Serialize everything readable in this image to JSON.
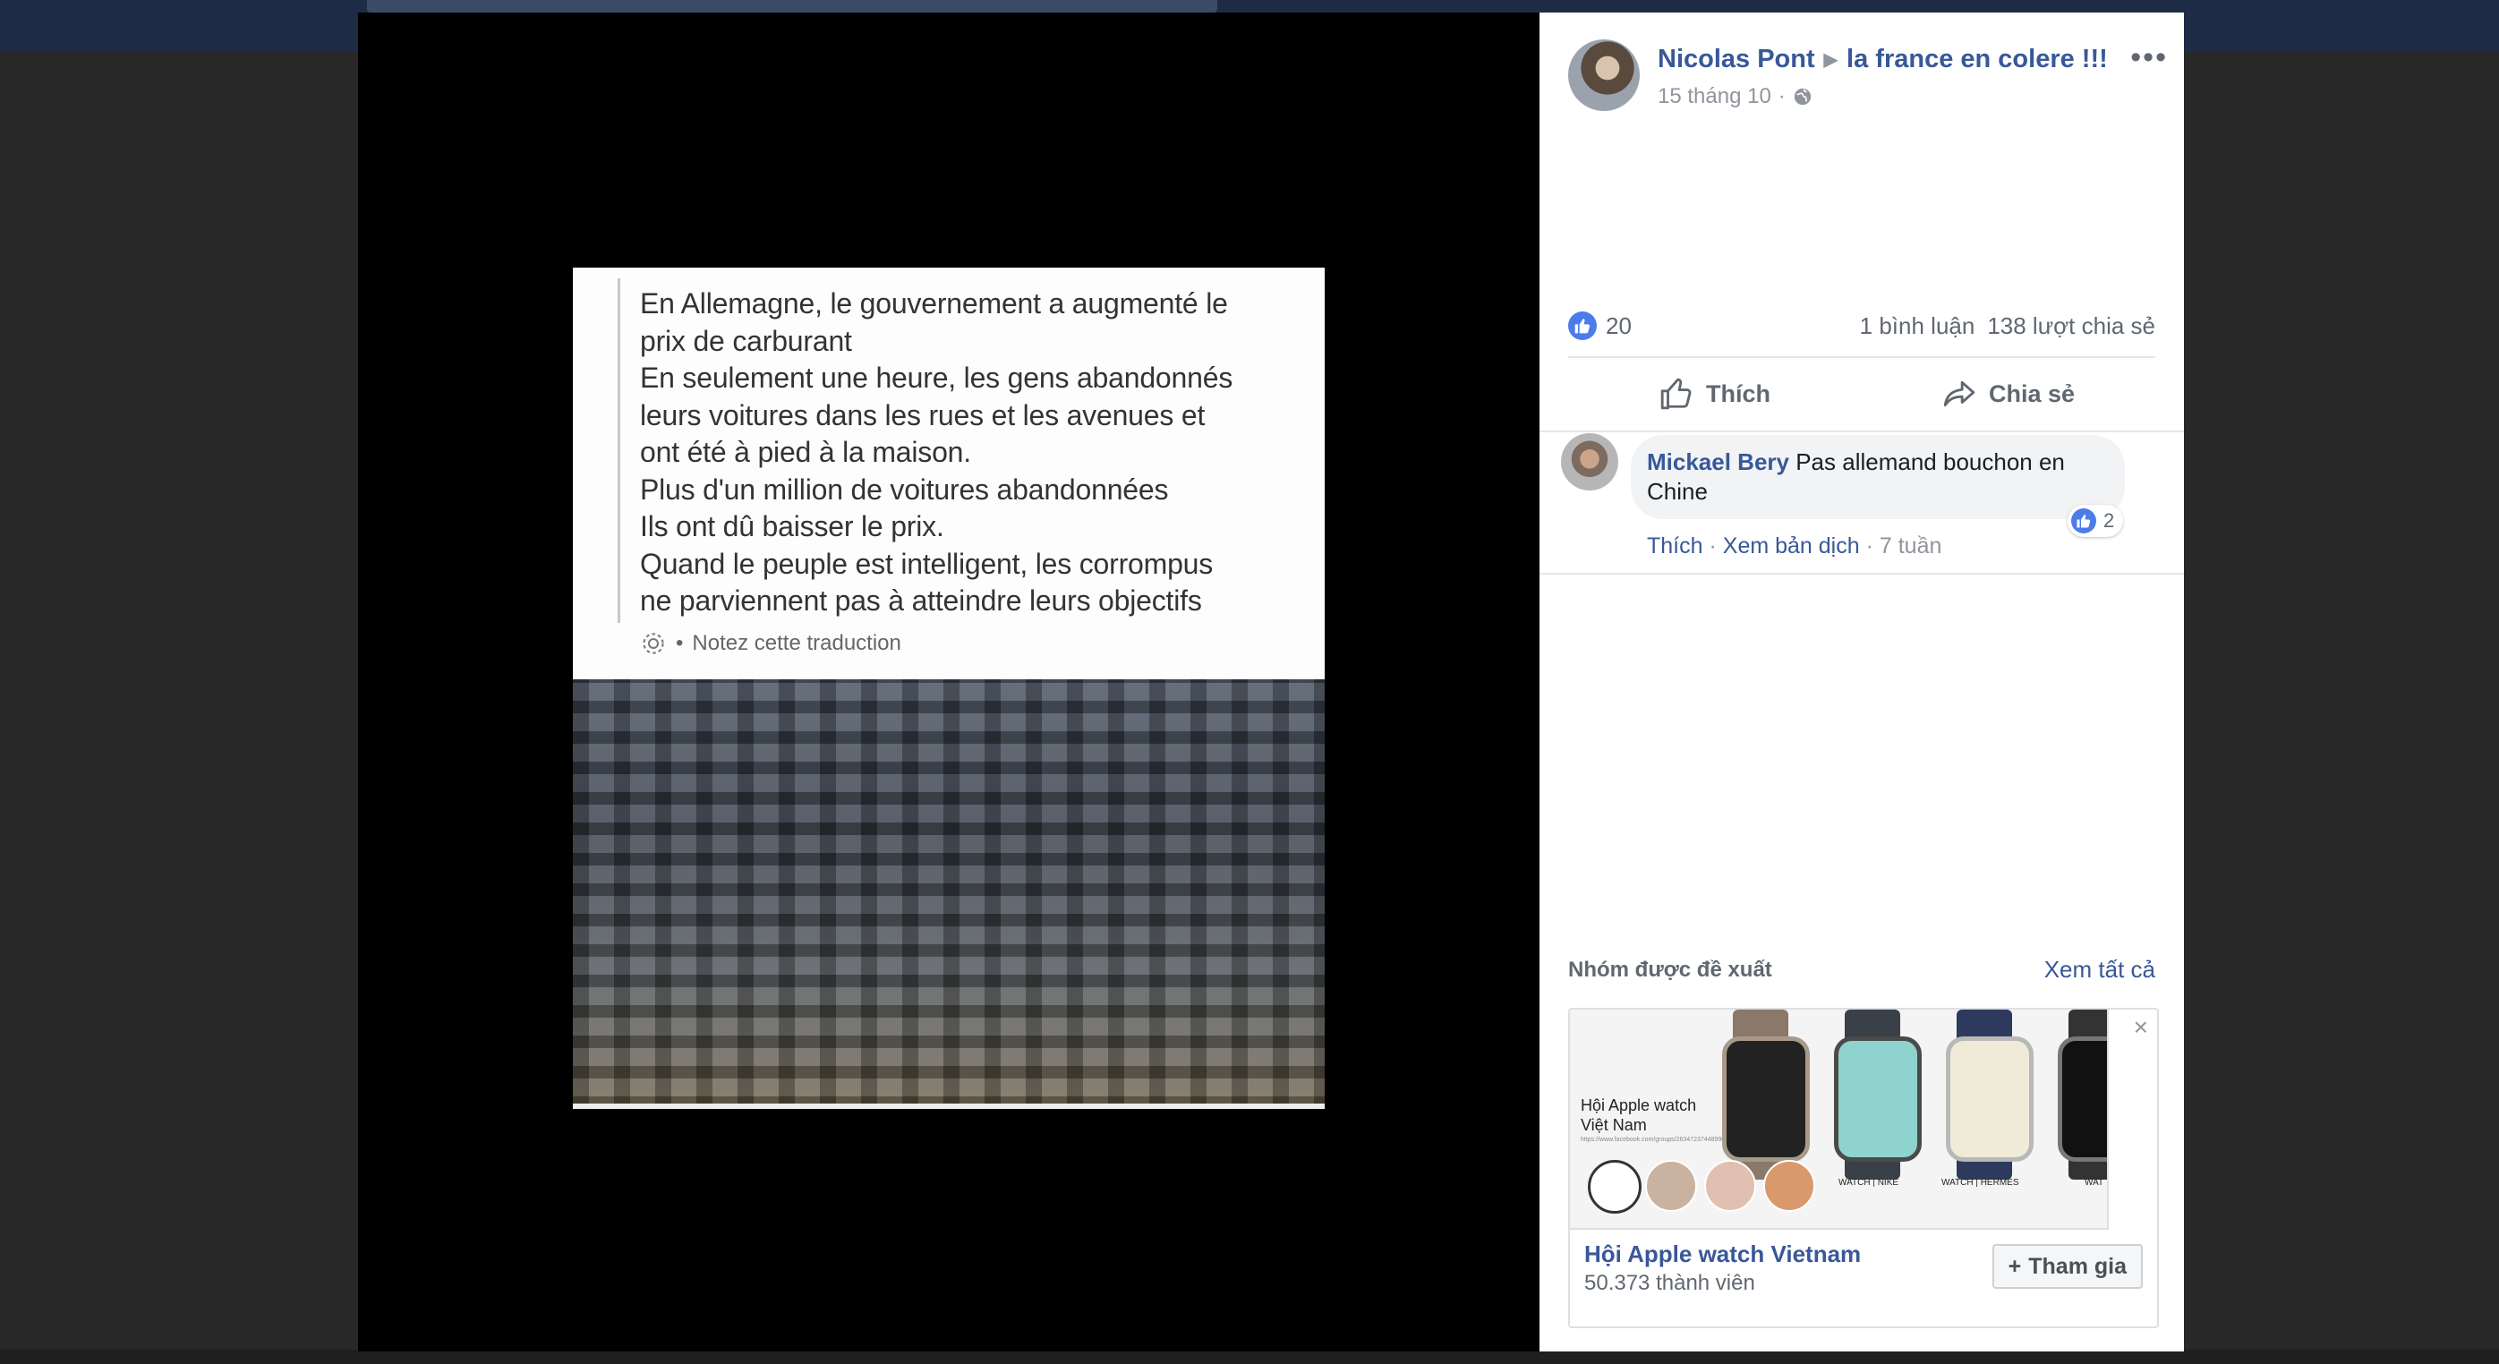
{
  "post_image": {
    "quote_text": "En Allemagne, le gouvernement a augmenté le\nprix de carburant\nEn seulement une heure, les gens abandonnés\nleurs voitures dans les rues et les avenues et\nont été à pied à la maison.\nPlus d'un million de voitures abandonnées\nIls ont dû baisser le prix.\nQuand le peuple est intelligent, les corrompus\nne parviennent pas à atteindre leurs objectifs",
    "note_separator": "•",
    "note_label": "Notez cette traduction"
  },
  "post": {
    "author": "Nicolas Pont",
    "group": "la france en colere !!!",
    "date": "15 tháng 10",
    "meta_separator": "·",
    "more_label": "•••",
    "privacy_icon": "globe-icon"
  },
  "stats": {
    "likes": "20",
    "comments": "1 bình luận",
    "shares": "138 lượt chia sẻ"
  },
  "actions": {
    "like_label": "Thích",
    "share_label": "Chia sẻ"
  },
  "comment": {
    "author": "Mickael Bery",
    "text": "Pas allemand bouchon en Chine",
    "like_label": "Thích",
    "sep1": "·",
    "translate_label": "Xem bản dịch",
    "sep2": "·",
    "time": "7 tuần",
    "reaction_count": "2"
  },
  "suggested": {
    "title": "Nhóm được đề xuất",
    "see_all": "Xem tất cả",
    "close_label": "×",
    "image_title": "Hội Apple watch\nViệt Nam",
    "image_url": "https://www.facebook.com/groups/263472374489903/",
    "watch_labels": [
      "WATCH | NIKE",
      "WATCH | HERMÈS",
      "WAT"
    ],
    "group_name": "Hội Apple watch Vietnam",
    "members": "50.373 thành viên",
    "join_label": "Tham gia"
  },
  "colors": {
    "link_blue": "#385898",
    "like_blue": "#4c7bea",
    "meta_gray": "#90949c"
  }
}
